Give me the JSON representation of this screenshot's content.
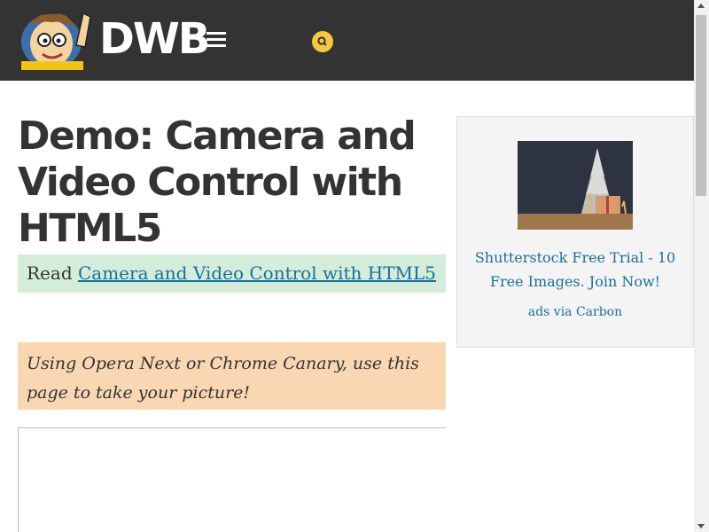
{
  "header": {
    "logo_text": "DWB",
    "mascot_icon": "cartoon-mascot-logo",
    "menu_icon": "hamburger-menu-icon",
    "search_icon": "search-icon",
    "background_color": "#333333",
    "search_color": "#f5c842"
  },
  "main": {
    "title": "Demo: Camera and Video Control with HTML5",
    "read_label": "Read",
    "read_link": "Camera and Video Control with HTML5",
    "note": "Using Opera Next or Chrome Canary, use this page to take your picture!",
    "colors": {
      "read_box": "#d4edda",
      "note_box": "#fad7b3",
      "link": "#1a6e9a"
    }
  },
  "ad": {
    "image_icon": "christmas-tree-chalkboard-image",
    "text": "Shutterstock Free Trial - 10 Free Images. Join Now!",
    "via": "ads via Carbon"
  }
}
